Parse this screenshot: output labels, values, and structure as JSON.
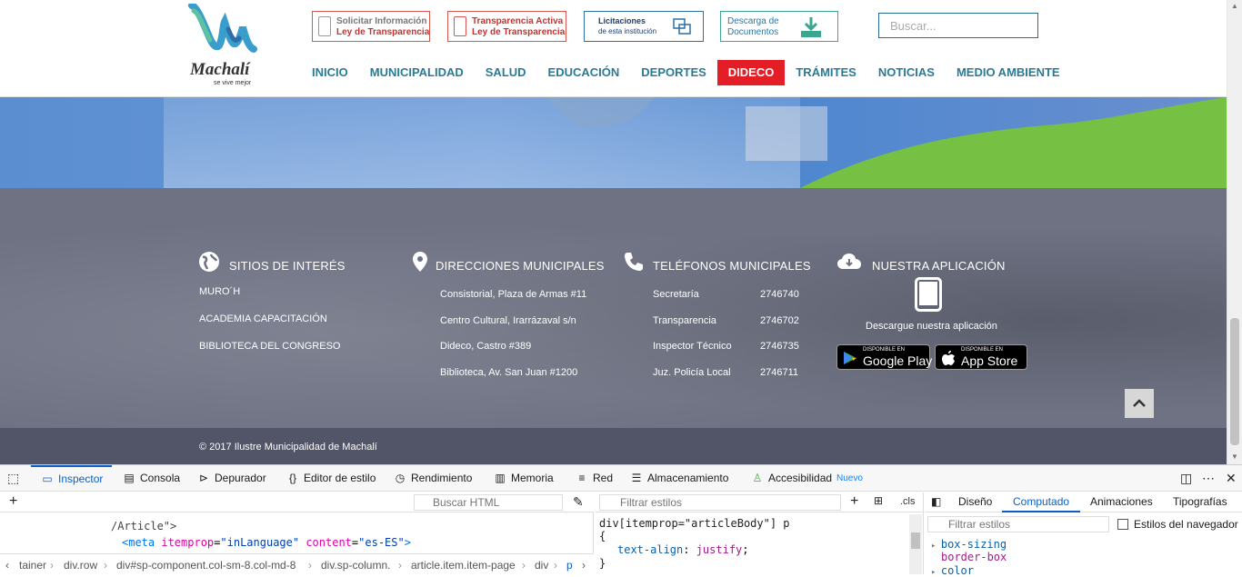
{
  "header": {
    "logo_name": "Machalí",
    "logo_slogan": "se vive mejor",
    "banners": {
      "solicitar": {
        "line1": "Solicitar Información",
        "line2": "Ley de Transparencia"
      },
      "transparencia": {
        "line1": "Transparencia Activa",
        "line2": "Ley de Transparencia"
      },
      "licitaciones": {
        "line1": "Licitaciones",
        "line2": "de esta institución"
      },
      "descarga": {
        "line1": "Descarga de",
        "line2": "Documentos"
      }
    },
    "search_placeholder": "Buscar...",
    "nav": [
      "INICIO",
      "MUNICIPALIDAD",
      "SALUD",
      "EDUCACIÓN",
      "DEPORTES",
      "DIDECO",
      "TRÁMITES",
      "NOTICIAS",
      "MEDIO AMBIENTE"
    ],
    "nav_active": "DIDECO",
    "nav_active_color": "#e41e26",
    "nav_color": "#2a7a96"
  },
  "footer": {
    "sitios": {
      "title": "SITIOS DE INTERÉS",
      "items": [
        "MURO´H",
        "ACADEMIA CAPACITACIÓN",
        "BIBLIOTECA DEL CONGRESO"
      ]
    },
    "direcciones": {
      "title": "DIRECCIONES MUNICIPALES",
      "items": [
        "Consistorial, Plaza de Armas #11",
        "Centro Cultural, Irarrázaval s/n",
        "Dideco, Castro #389",
        "Biblioteca, Av. San Juan #1200"
      ]
    },
    "telefonos": {
      "title": "TELÉFONOS MUNICIPALES",
      "rows": [
        {
          "name": "Secretaría",
          "number": "2746740"
        },
        {
          "name": "Transparencia",
          "number": "2746702"
        },
        {
          "name": "Inspector Técnico",
          "number": "2746735"
        },
        {
          "name": "Juz. Policía Local",
          "number": "2746711"
        }
      ]
    },
    "aplicacion": {
      "title": "NUESTRA APLICACIÓN",
      "text": "Descargue nuestra aplicación",
      "google": {
        "small": "DISPONIBLE EN",
        "big": "Google Play"
      },
      "apple": {
        "small": "DISPONIBLE EN",
        "big": "App Store"
      }
    },
    "copyright": "© 2017 Ilustre Municipalidad de Machalí"
  },
  "devtools": {
    "tabs": [
      "Inspector",
      "Consola",
      "Depurador",
      "Editor de estilo",
      "Rendimiento",
      "Memoria",
      "Red",
      "Almacenamiento",
      "Accesibilidad"
    ],
    "tab_icons": [
      "inspector-icon",
      "console-icon",
      "debugger-icon",
      "style-editor-icon",
      "performance-icon",
      "memory-icon",
      "network-icon",
      "storage-icon",
      "accessibility-icon"
    ],
    "selected_tab": "Inspector",
    "new_badge": "Nuevo",
    "search_html_placeholder": "Buscar HTML",
    "markup_lines": {
      "line0": "/Article\">",
      "line1_tag": "<meta",
      "line1_attr1": "itemprop",
      "line1_val1": "\"inLanguage\"",
      "line1_attr2": "content",
      "line1_val2": "\"es-ES\"",
      "line1_end": ">"
    },
    "rules_filter_placeholder": "Filtrar estilos",
    "cls_label": ".cls",
    "rule": {
      "selector": "div[itemprop=\"articleBody\"] p",
      "open": "{",
      "property": "text-align",
      "value": "justify",
      "close": "}"
    },
    "side_tabs": [
      "Diseño",
      "Computado",
      "Animaciones",
      "Tipografías"
    ],
    "side_selected": "Computado",
    "side_filter_placeholder": "Filtrar estilos",
    "browser_styles": "Estilos del navegador",
    "computed": [
      {
        "prop": "box-sizing",
        "value": "border-box"
      },
      {
        "prop": "color",
        "value": ""
      }
    ],
    "breadcrumb": [
      "tainer",
      "div.row",
      "div#sp-component.col-sm-8.col-md-8",
      "div.sp-column.",
      "article.item.item-page",
      "div",
      "p"
    ]
  }
}
